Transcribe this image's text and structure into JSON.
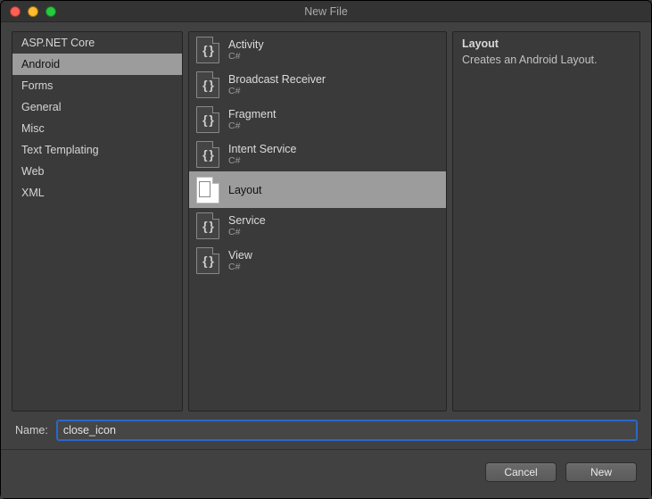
{
  "window": {
    "title": "New File"
  },
  "categories": [
    {
      "label": "ASP.NET Core",
      "selected": false
    },
    {
      "label": "Android",
      "selected": true
    },
    {
      "label": "Forms",
      "selected": false
    },
    {
      "label": "General",
      "selected": false
    },
    {
      "label": "Misc",
      "selected": false
    },
    {
      "label": "Text Templating",
      "selected": false
    },
    {
      "label": "Web",
      "selected": false
    },
    {
      "label": "XML",
      "selected": false
    }
  ],
  "templates": [
    {
      "label": "Activity",
      "sub": "C#",
      "icon": "code",
      "selected": false
    },
    {
      "label": "Broadcast Receiver",
      "sub": "C#",
      "icon": "code",
      "selected": false
    },
    {
      "label": "Fragment",
      "sub": "C#",
      "icon": "code",
      "selected": false
    },
    {
      "label": "Intent Service",
      "sub": "C#",
      "icon": "code",
      "selected": false
    },
    {
      "label": "Layout",
      "sub": "",
      "icon": "layout",
      "selected": true
    },
    {
      "label": "Service",
      "sub": "C#",
      "icon": "code",
      "selected": false
    },
    {
      "label": "View",
      "sub": "C#",
      "icon": "code",
      "selected": false
    }
  ],
  "description": {
    "title": "Layout",
    "body": "Creates an Android Layout."
  },
  "name_field": {
    "label": "Name:",
    "value": "close_icon"
  },
  "buttons": {
    "cancel": "Cancel",
    "confirm": "New"
  }
}
